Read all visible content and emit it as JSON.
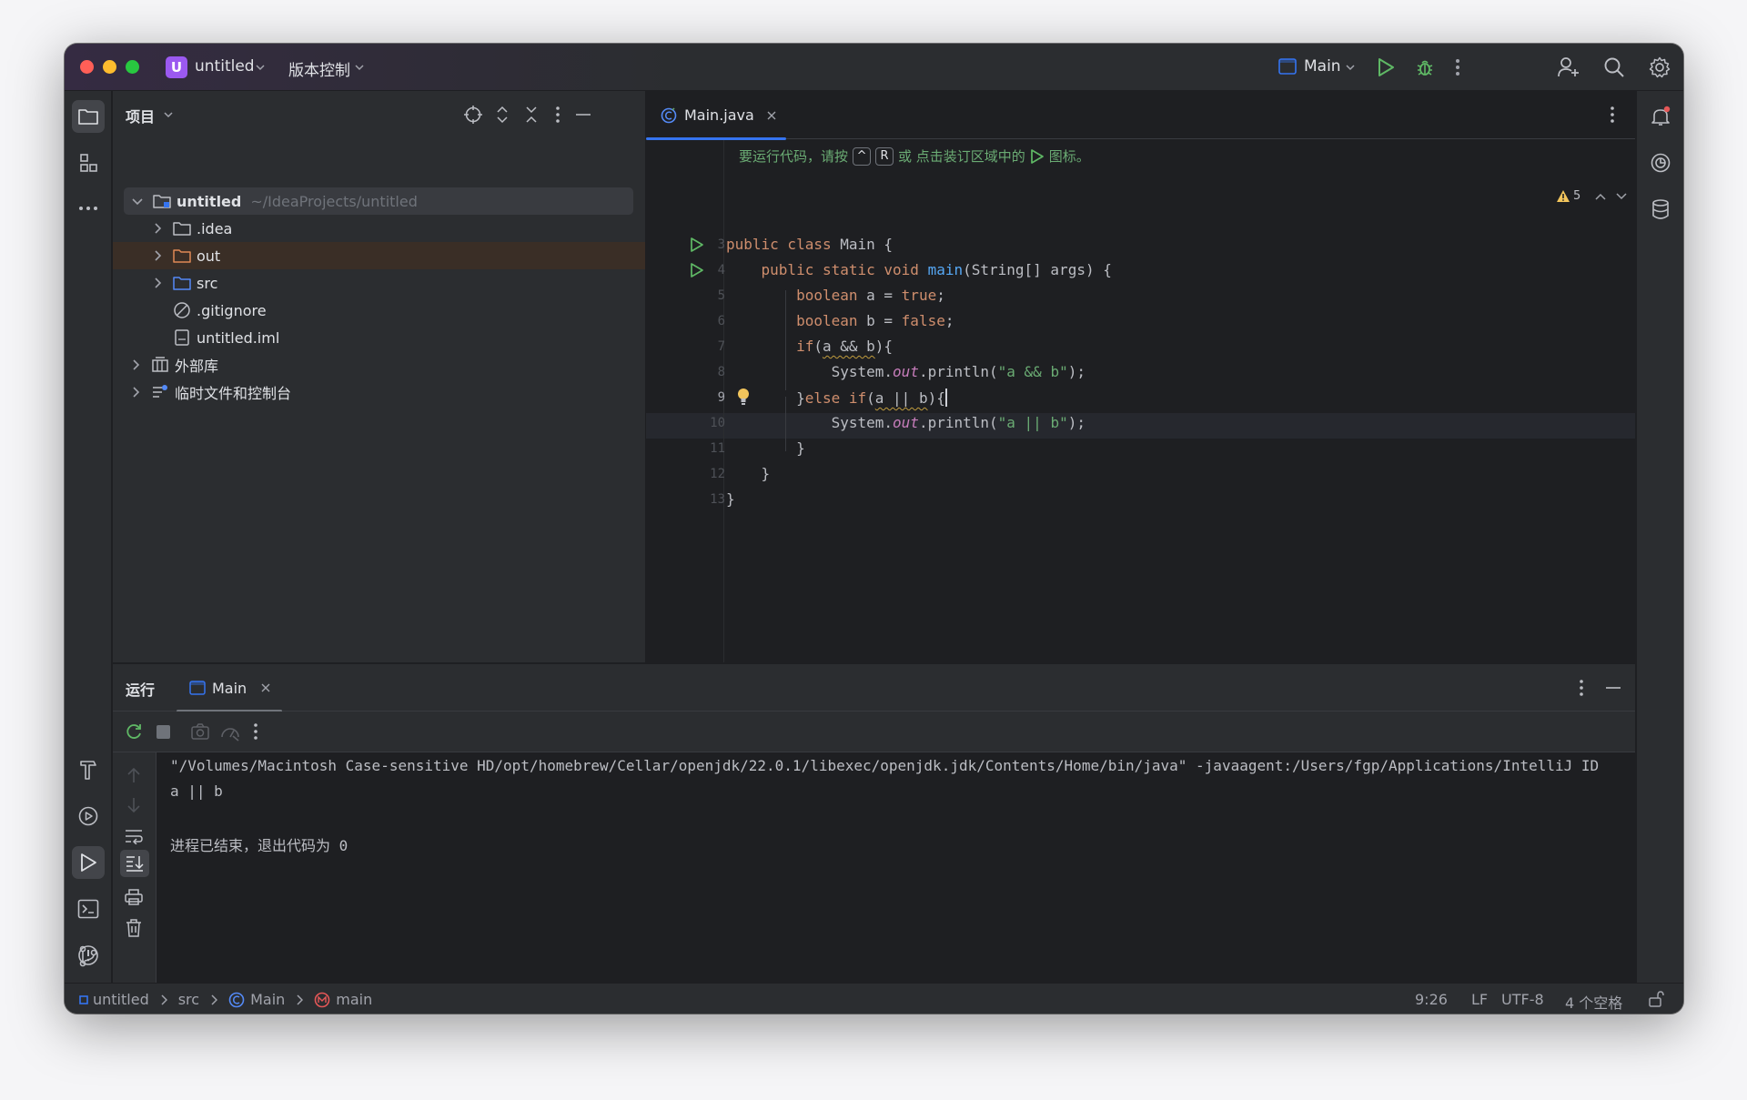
{
  "titlebar": {
    "project_badge": "U",
    "project_name": "untitled",
    "vcs_label": "版本控制",
    "run_config": "Main"
  },
  "project_panel": {
    "title": "项目",
    "tree": [
      {
        "name": "untitled",
        "path": "~/IdeaProjects/untitled"
      },
      {
        "name": ".idea"
      },
      {
        "name": "out"
      },
      {
        "name": "src"
      },
      {
        "name": ".gitignore"
      },
      {
        "name": "untitled.iml"
      },
      {
        "name": "外部库"
      },
      {
        "name": "临时文件和控制台"
      }
    ]
  },
  "editor": {
    "tab_label": "Main.java",
    "hint": {
      "text_before": "要运行代码，请按",
      "key1": "^",
      "key2": "R",
      "text_after": "或 点击装订区域中的",
      "text_end": "图标。"
    },
    "warning_count": "5",
    "line_numbers": [
      "3",
      "4",
      "5",
      "6",
      "7",
      "8",
      "9",
      "10",
      "11",
      "12",
      "13"
    ],
    "code": {
      "l3": {
        "kw": "public class",
        "rest": " Main {"
      },
      "l4": {
        "kw": "public static void",
        "fn": "main",
        "rest": "(String[] args) {"
      },
      "l5": {
        "kw": "boolean",
        "mid": " a = ",
        "kw2": "true",
        "end": ";"
      },
      "l6": {
        "kw": "boolean",
        "mid": " b = ",
        "kw2": "false",
        "end": ";"
      },
      "l7": {
        "kw": "if",
        "open": "(",
        "cond": "a && b",
        "close": "){"
      },
      "l8": {
        "pre": "System.",
        "fld": "out",
        "mid": ".println(",
        "str": "\"a && b\"",
        "end": ");"
      },
      "l9": {
        "brace": "}",
        "kw": "else if",
        "open": "(",
        "cond": "a || b",
        "close": "){"
      },
      "l10": {
        "pre": "System.",
        "fld": "out",
        "mid": ".println(",
        "str": "\"a || b\"",
        "end": ");"
      },
      "l11": "}",
      "l12": "}",
      "l13": "}"
    }
  },
  "run_panel": {
    "title": "运行",
    "tab_label": "Main",
    "console": [
      "\"/Volumes/Macintosh Case-sensitive HD/opt/homebrew/Cellar/openjdk/22.0.1/libexec/openjdk.jdk/Contents/Home/bin/java\" -javaagent:/Users/fgp/Applications/IntelliJ ID",
      "a || b",
      "",
      "进程已结束，退出代码为 0"
    ]
  },
  "statusbar": {
    "breadcrumbs": [
      "untitled",
      "src",
      "Main",
      "main"
    ],
    "position": "9:26",
    "line_sep": "LF",
    "encoding": "UTF-8",
    "indent": "4 个空格"
  },
  "colors": {
    "accent": "#3574f0",
    "run_green": "#5fb865",
    "badge_purple": "#9b59f0"
  }
}
